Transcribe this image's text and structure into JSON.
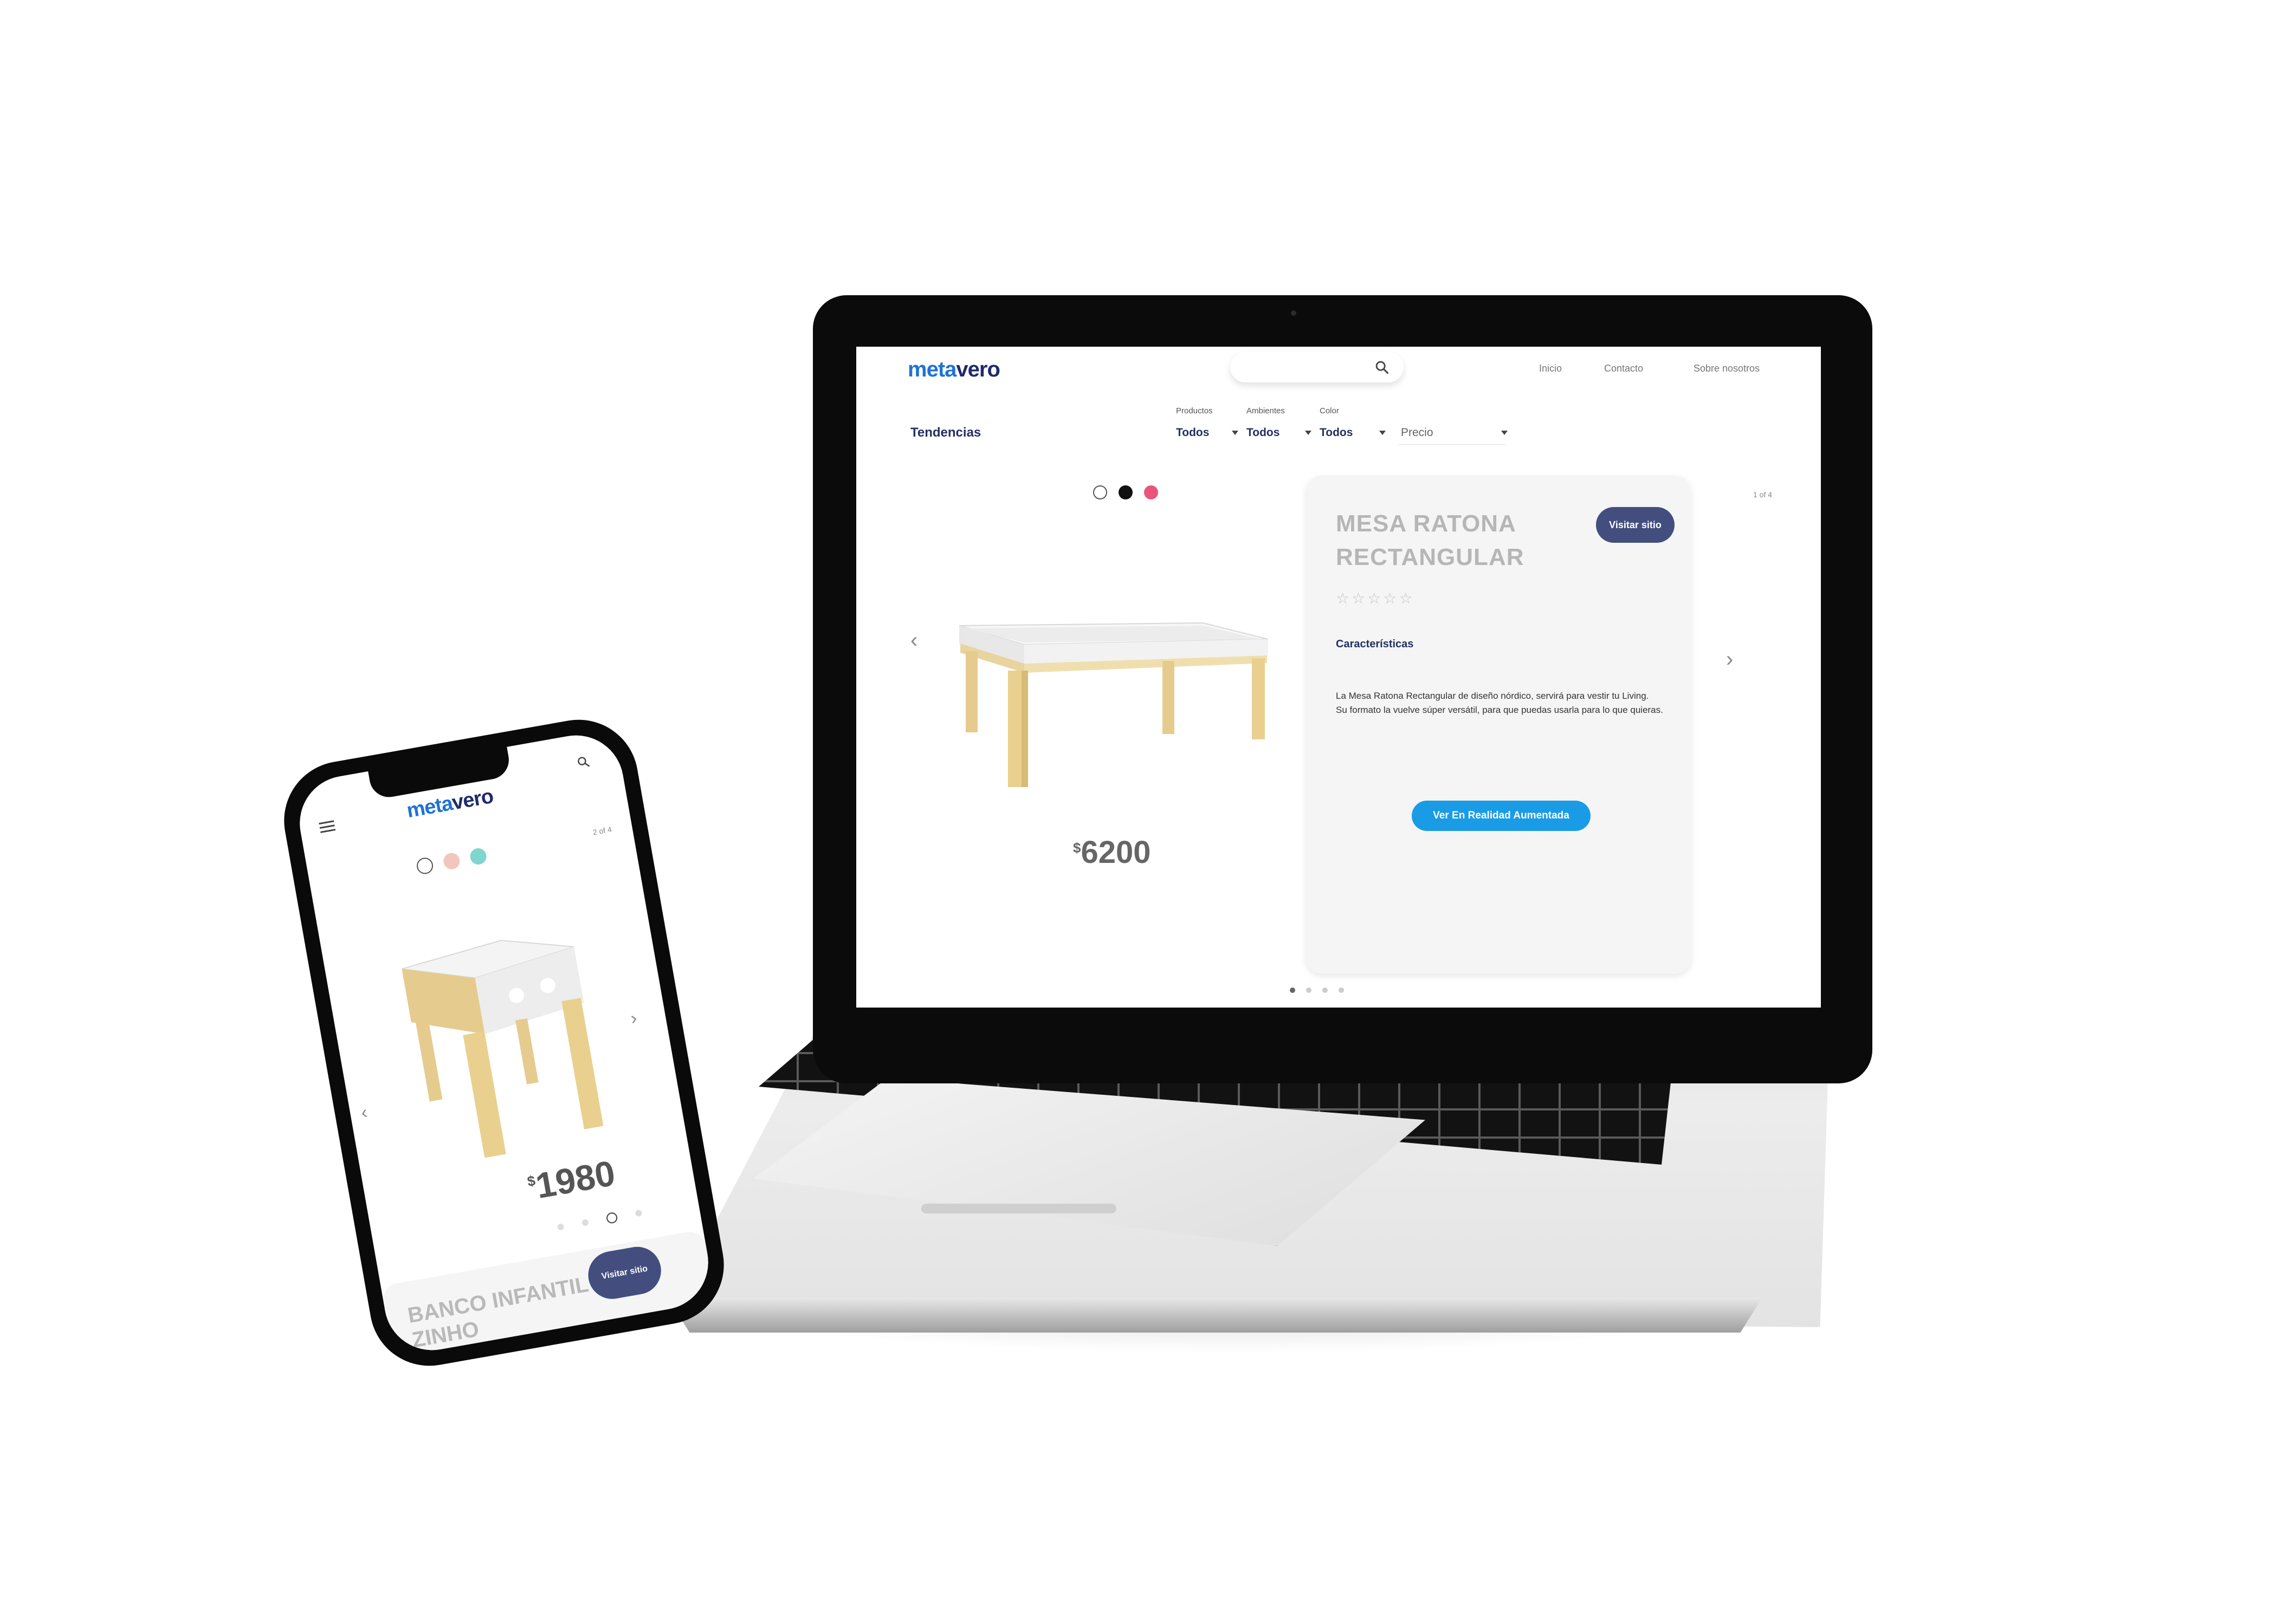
{
  "laptop": {
    "brand": {
      "logo_part1": "meta",
      "logo_part2": "vero"
    },
    "nav": {
      "inicio": "Inicio",
      "contacto": "Contacto",
      "sobre": "Sobre nosotros"
    },
    "section_title": "Tendencias",
    "filters": [
      {
        "label": "Productos",
        "value": "Todos"
      },
      {
        "label": "Ambientes",
        "value": "Todos"
      },
      {
        "label": "Color",
        "value": "Todos"
      }
    ],
    "price_filter": "Precio",
    "swatches": [
      "#ffffff",
      "#111111",
      "#e9557a"
    ],
    "product": {
      "price_currency": "$",
      "price_amount": "6200",
      "title": "MESA RATONA RECTANGULAR",
      "visit_label": "Visitar sitio",
      "stars": "☆☆☆☆☆",
      "features_label": "Características",
      "desc_1": "La Mesa Ratona Rectangular de diseño nórdico, servirá para vestir tu Living.",
      "desc_2": "Su formato la vuelve súper versátil, para que puedas usarla para lo que quieras.",
      "ar_button": "Ver En Realidad Aumentada"
    },
    "page_count": "1 of 4",
    "carousel_dots": 4,
    "active_dot": 1
  },
  "phone": {
    "brand": {
      "logo_part1": "meta",
      "logo_part2": "vero"
    },
    "swatches": [
      "#ffffff",
      "#f3c6bd",
      "#7fd6cf"
    ],
    "page_count": "2 of 4",
    "product": {
      "price_currency": "$",
      "price_amount": "1980",
      "title": "BANCO INFANTIL ZINHO",
      "visit_label": "Visitar sitio"
    },
    "carousel_dots": 4,
    "active_dot": 3
  },
  "icons": [
    "search-icon",
    "menu-icon",
    "chevron-left-icon",
    "chevron-right-icon",
    "star-icon",
    "camera-icon"
  ]
}
